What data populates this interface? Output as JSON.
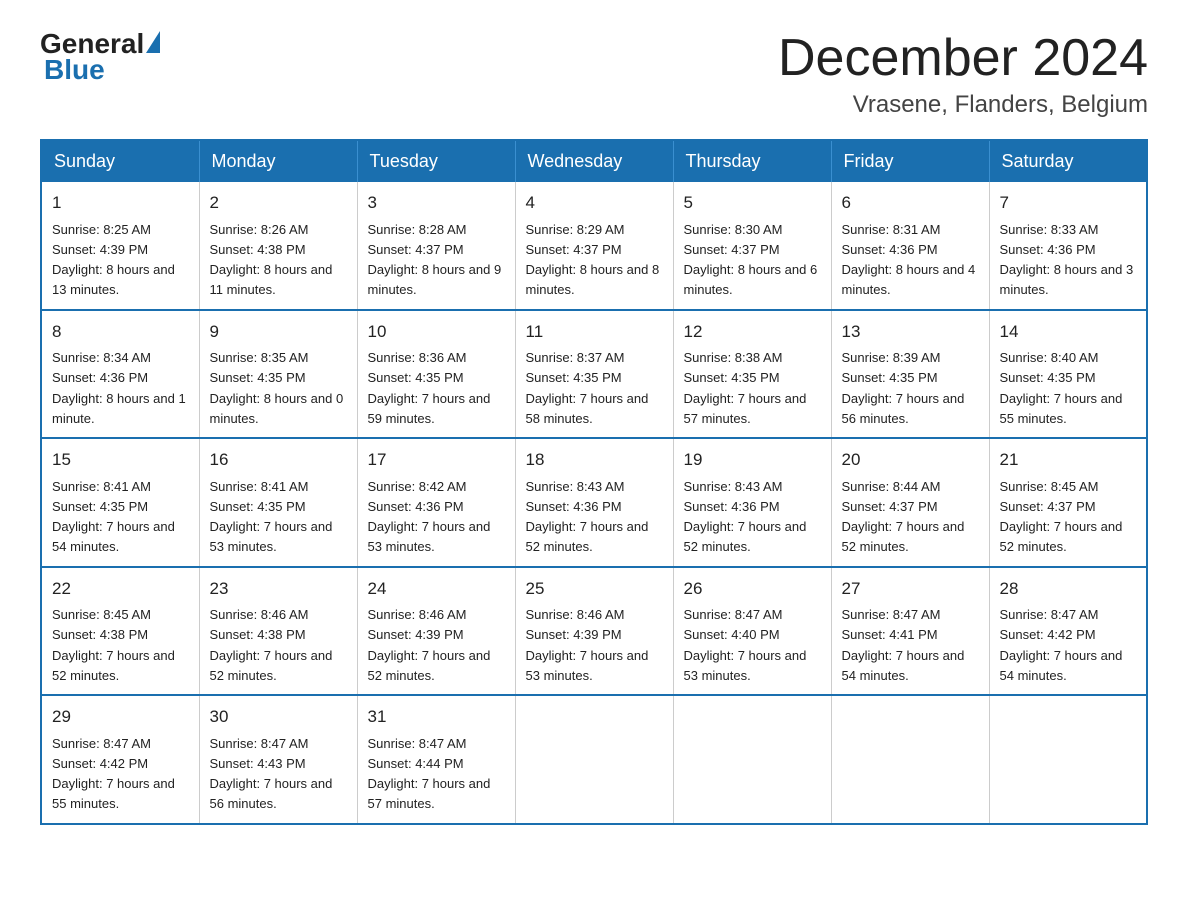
{
  "header": {
    "logo_general": "General",
    "logo_blue": "Blue",
    "month_title": "December 2024",
    "location": "Vrasene, Flanders, Belgium"
  },
  "weekdays": [
    "Sunday",
    "Monday",
    "Tuesday",
    "Wednesday",
    "Thursday",
    "Friday",
    "Saturday"
  ],
  "weeks": [
    [
      {
        "day": "1",
        "sunrise": "8:25 AM",
        "sunset": "4:39 PM",
        "daylight": "8 hours and 13 minutes."
      },
      {
        "day": "2",
        "sunrise": "8:26 AM",
        "sunset": "4:38 PM",
        "daylight": "8 hours and 11 minutes."
      },
      {
        "day": "3",
        "sunrise": "8:28 AM",
        "sunset": "4:37 PM",
        "daylight": "8 hours and 9 minutes."
      },
      {
        "day": "4",
        "sunrise": "8:29 AM",
        "sunset": "4:37 PM",
        "daylight": "8 hours and 8 minutes."
      },
      {
        "day": "5",
        "sunrise": "8:30 AM",
        "sunset": "4:37 PM",
        "daylight": "8 hours and 6 minutes."
      },
      {
        "day": "6",
        "sunrise": "8:31 AM",
        "sunset": "4:36 PM",
        "daylight": "8 hours and 4 minutes."
      },
      {
        "day": "7",
        "sunrise": "8:33 AM",
        "sunset": "4:36 PM",
        "daylight": "8 hours and 3 minutes."
      }
    ],
    [
      {
        "day": "8",
        "sunrise": "8:34 AM",
        "sunset": "4:36 PM",
        "daylight": "8 hours and 1 minute."
      },
      {
        "day": "9",
        "sunrise": "8:35 AM",
        "sunset": "4:35 PM",
        "daylight": "8 hours and 0 minutes."
      },
      {
        "day": "10",
        "sunrise": "8:36 AM",
        "sunset": "4:35 PM",
        "daylight": "7 hours and 59 minutes."
      },
      {
        "day": "11",
        "sunrise": "8:37 AM",
        "sunset": "4:35 PM",
        "daylight": "7 hours and 58 minutes."
      },
      {
        "day": "12",
        "sunrise": "8:38 AM",
        "sunset": "4:35 PM",
        "daylight": "7 hours and 57 minutes."
      },
      {
        "day": "13",
        "sunrise": "8:39 AM",
        "sunset": "4:35 PM",
        "daylight": "7 hours and 56 minutes."
      },
      {
        "day": "14",
        "sunrise": "8:40 AM",
        "sunset": "4:35 PM",
        "daylight": "7 hours and 55 minutes."
      }
    ],
    [
      {
        "day": "15",
        "sunrise": "8:41 AM",
        "sunset": "4:35 PM",
        "daylight": "7 hours and 54 minutes."
      },
      {
        "day": "16",
        "sunrise": "8:41 AM",
        "sunset": "4:35 PM",
        "daylight": "7 hours and 53 minutes."
      },
      {
        "day": "17",
        "sunrise": "8:42 AM",
        "sunset": "4:36 PM",
        "daylight": "7 hours and 53 minutes."
      },
      {
        "day": "18",
        "sunrise": "8:43 AM",
        "sunset": "4:36 PM",
        "daylight": "7 hours and 52 minutes."
      },
      {
        "day": "19",
        "sunrise": "8:43 AM",
        "sunset": "4:36 PM",
        "daylight": "7 hours and 52 minutes."
      },
      {
        "day": "20",
        "sunrise": "8:44 AM",
        "sunset": "4:37 PM",
        "daylight": "7 hours and 52 minutes."
      },
      {
        "day": "21",
        "sunrise": "8:45 AM",
        "sunset": "4:37 PM",
        "daylight": "7 hours and 52 minutes."
      }
    ],
    [
      {
        "day": "22",
        "sunrise": "8:45 AM",
        "sunset": "4:38 PM",
        "daylight": "7 hours and 52 minutes."
      },
      {
        "day": "23",
        "sunrise": "8:46 AM",
        "sunset": "4:38 PM",
        "daylight": "7 hours and 52 minutes."
      },
      {
        "day": "24",
        "sunrise": "8:46 AM",
        "sunset": "4:39 PM",
        "daylight": "7 hours and 52 minutes."
      },
      {
        "day": "25",
        "sunrise": "8:46 AM",
        "sunset": "4:39 PM",
        "daylight": "7 hours and 53 minutes."
      },
      {
        "day": "26",
        "sunrise": "8:47 AM",
        "sunset": "4:40 PM",
        "daylight": "7 hours and 53 minutes."
      },
      {
        "day": "27",
        "sunrise": "8:47 AM",
        "sunset": "4:41 PM",
        "daylight": "7 hours and 54 minutes."
      },
      {
        "day": "28",
        "sunrise": "8:47 AM",
        "sunset": "4:42 PM",
        "daylight": "7 hours and 54 minutes."
      }
    ],
    [
      {
        "day": "29",
        "sunrise": "8:47 AM",
        "sunset": "4:42 PM",
        "daylight": "7 hours and 55 minutes."
      },
      {
        "day": "30",
        "sunrise": "8:47 AM",
        "sunset": "4:43 PM",
        "daylight": "7 hours and 56 minutes."
      },
      {
        "day": "31",
        "sunrise": "8:47 AM",
        "sunset": "4:44 PM",
        "daylight": "7 hours and 57 minutes."
      },
      null,
      null,
      null,
      null
    ]
  ]
}
